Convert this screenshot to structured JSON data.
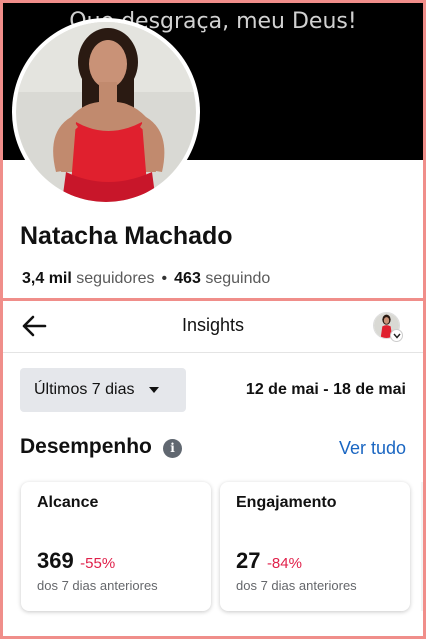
{
  "cover": {
    "caption": "Que desgraça, meu Deus!"
  },
  "profile": {
    "name": "Natacha Machado",
    "followers_count": "3,4 mil",
    "followers_label": "seguidores",
    "separator": "•",
    "following_count": "463",
    "following_label": "seguindo"
  },
  "header": {
    "title": "Insights",
    "back_icon": "arrow-left-icon",
    "account_icon": "account-switcher-icon"
  },
  "filters": {
    "period_selected": "Últimos 7 dias",
    "date_range": "12 de mai - 18 de mai"
  },
  "performance": {
    "title": "Desempenho",
    "info_icon_glyph": "i",
    "see_all": "Ver tudo",
    "cards": [
      {
        "label": "Alcance",
        "value": "369",
        "change": "-55%",
        "subtext": "dos 7 dias anteriores"
      },
      {
        "label": "Engajamento",
        "value": "27",
        "change": "-84%",
        "subtext": "dos 7 dias anteriores"
      }
    ]
  },
  "colors": {
    "accent_link": "#1a66c2",
    "negative_change": "#e0204a",
    "frame_border": "#f08e8a"
  }
}
